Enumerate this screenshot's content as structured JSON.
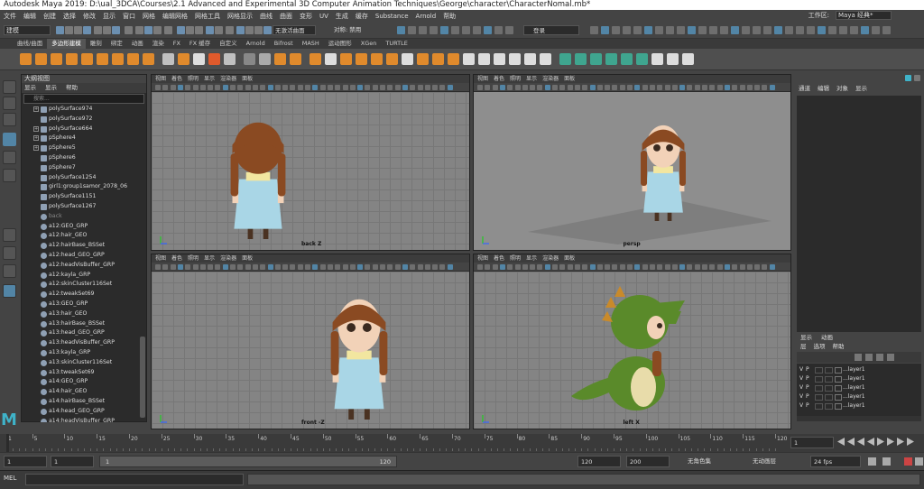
{
  "window": {
    "title": "Autodesk Maya 2019: D:\\ual_3DCA\\Courses\\2.1 Advanced and Experimental 3D Computer Animation Techniques\\George\\character\\CharacterNomal.mb*"
  },
  "menu": [
    "文件",
    "编辑",
    "创建",
    "选择",
    "修改",
    "显示",
    "窗口",
    "网格",
    "编辑网格",
    "网格工具",
    "网格显示",
    "曲线",
    "曲面",
    "变形",
    "UV",
    "生成",
    "缓存",
    "Substance",
    "Arnold",
    "帮助"
  ],
  "workspace": {
    "label": "工作区:",
    "value": "Maya 经典*"
  },
  "status_line": {
    "mode": "建模",
    "live_surface": "无激活曲面",
    "symmetry": "对称: 禁用",
    "login": "登录"
  },
  "shelf_tabs": [
    "曲线/曲面",
    "多边形建模",
    "雕刻",
    "绑定",
    "动画",
    "渲染",
    "FX",
    "FX 缓存",
    "自定义",
    "Arnold",
    "Bifrost",
    "MASH",
    "运动图形",
    "XGen",
    "TURTLE"
  ],
  "shelf_active": 1,
  "outliner": {
    "title": "大纲视图",
    "menu": [
      "显示",
      "显示",
      "帮助"
    ],
    "search_placeholder": "搜索...",
    "items": [
      {
        "label": "polySurface974",
        "expand": true
      },
      {
        "label": "polySurface972",
        "expand": false
      },
      {
        "label": "polySurface664",
        "expand": true
      },
      {
        "label": "pSphere4",
        "expand": true
      },
      {
        "label": "pSphere5",
        "expand": true
      },
      {
        "label": "pSphere6",
        "expand": false
      },
      {
        "label": "pSphere7",
        "expand": false
      },
      {
        "label": "polySurface1254",
        "expand": false
      },
      {
        "label": "girl1:group1samor_2078_06",
        "expand": false
      },
      {
        "label": "polySurface1151",
        "expand": false
      },
      {
        "label": "polySurface1267",
        "expand": false
      },
      {
        "label": "back",
        "expand": false,
        "dim": true
      },
      {
        "label": "a12:GEO_GRP",
        "expand": false
      },
      {
        "label": "a12:hair_GEO",
        "expand": false
      },
      {
        "label": "a12:hairBase_BSSet",
        "expand": false
      },
      {
        "label": "a12:head_GEO_GRP",
        "expand": false
      },
      {
        "label": "a12:headVisBuffer_GRP",
        "expand": false
      },
      {
        "label": "a12:kayla_GRP",
        "expand": false
      },
      {
        "label": "a12:skinCluster116Set",
        "expand": false
      },
      {
        "label": "a12:tweakSet69",
        "expand": false
      },
      {
        "label": "a13:GEO_GRP",
        "expand": false
      },
      {
        "label": "a13:hair_GEO",
        "expand": false
      },
      {
        "label": "a13:hairBase_BSSet",
        "expand": false
      },
      {
        "label": "a13:head_GEO_GRP",
        "expand": false
      },
      {
        "label": "a13:headVisBuffer_GRP",
        "expand": false
      },
      {
        "label": "a13:kayla_GRP",
        "expand": false
      },
      {
        "label": "a13:skinCluster116Set",
        "expand": false
      },
      {
        "label": "a13:tweakSet69",
        "expand": false
      },
      {
        "label": "a14:GEO_GRP",
        "expand": false
      },
      {
        "label": "a14:hair_GEO",
        "expand": false
      },
      {
        "label": "a14:hairBase_BSSet",
        "expand": false
      },
      {
        "label": "a14:head_GEO_GRP",
        "expand": false
      },
      {
        "label": "a14:headVisBuffer_GRP",
        "expand": false
      }
    ]
  },
  "viewport_menu": [
    "视图",
    "着色",
    "照明",
    "显示",
    "渲染器",
    "面板"
  ],
  "viewports": [
    {
      "label": "back Z"
    },
    {
      "label": "persp"
    },
    {
      "label": "front -Z"
    },
    {
      "label": "left X"
    }
  ],
  "channel_box": {
    "menu": [
      "通道",
      "编辑",
      "对象",
      "显示"
    ]
  },
  "layer_editor": {
    "tabs": [
      "显示",
      "动画"
    ],
    "menu": [
      "层",
      "选项",
      "帮助"
    ],
    "layers": [
      {
        "v": "V",
        "p": "P",
        "name": "...layer1"
      },
      {
        "v": "V",
        "p": "P",
        "name": "...layer1"
      },
      {
        "v": "V",
        "p": "P",
        "name": "...layer1"
      },
      {
        "v": "V",
        "p": "P",
        "name": "...layer1"
      },
      {
        "v": "V",
        "p": "P",
        "name": "...layer1"
      }
    ]
  },
  "timeline": {
    "ticks": [
      1,
      5,
      10,
      15,
      20,
      25,
      30,
      35,
      40,
      45,
      50,
      55,
      60,
      65,
      70,
      75,
      80,
      85,
      90,
      95,
      100,
      105,
      110,
      115,
      120
    ],
    "current_frame": "1"
  },
  "range": {
    "start": "1",
    "playback_start": "1",
    "slider_start": "1",
    "slider_end": "120",
    "playback_end": "120",
    "end": "200",
    "character_set": "无角色集",
    "anim_layer": "无动画层",
    "fps": "24 fps"
  },
  "command_line": {
    "lang": "MEL"
  },
  "colors": {
    "accent": "#5285a6",
    "shelf_orange": "#e08a2c",
    "shelf_green": "#3fa58f",
    "dino_green": "#5a8a2a",
    "hair_brown": "#8a4a22",
    "dress_blue": "#a9d6e6"
  }
}
